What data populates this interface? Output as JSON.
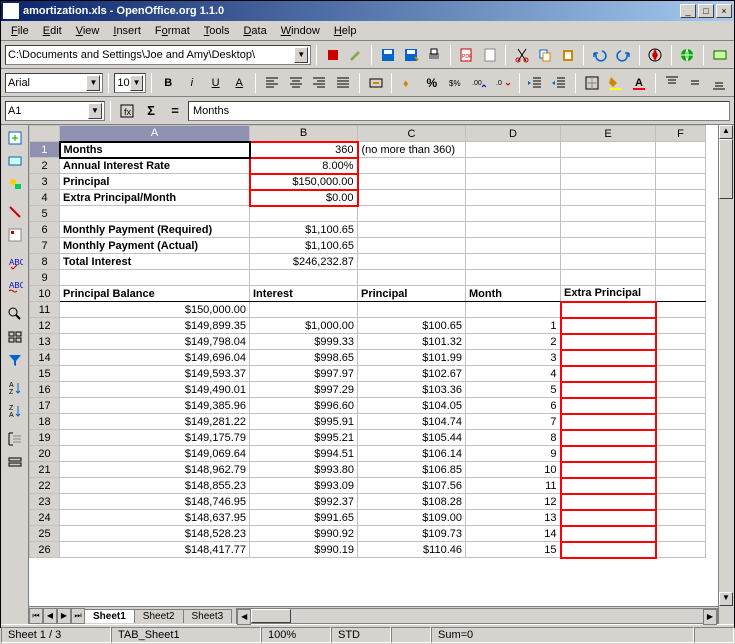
{
  "title": "amortization.xls - OpenOffice.org 1.1.0",
  "menu": [
    "File",
    "Edit",
    "View",
    "Insert",
    "Format",
    "Tools",
    "Data",
    "Window",
    "Help"
  ],
  "path": "C:\\Documents and Settings\\Joe and Amy\\Desktop\\",
  "font": "Arial",
  "fontsize": "10",
  "namebox": "A1",
  "formula": "Months",
  "columns": [
    "A",
    "B",
    "C",
    "D",
    "E",
    "F"
  ],
  "rows_visible": 26,
  "cells": {
    "r1": {
      "A": "Months",
      "B": "360",
      "C": "(no more than 360)"
    },
    "r2": {
      "A": "Annual Interest Rate",
      "B": "8.00%"
    },
    "r3": {
      "A": "Principal",
      "B": "$150,000.00"
    },
    "r4": {
      "A": "Extra Principal/Month",
      "B": "$0.00"
    },
    "r6": {
      "A": "Monthly Payment (Required)",
      "B": "$1,100.65"
    },
    "r7": {
      "A": "Monthly Payment (Actual)",
      "B": "$1,100.65"
    },
    "r8": {
      "A": "Total Interest",
      "B": "$246,232.87"
    },
    "r10": {
      "A": "Principal Balance",
      "B": "Interest",
      "C": "Principal",
      "D": "Month",
      "E": "Extra Principal"
    },
    "r11": {
      "A": "$150,000.00"
    },
    "r12": {
      "A": "$149,899.35",
      "B": "$1,000.00",
      "C": "$100.65",
      "D": "1"
    },
    "r13": {
      "A": "$149,798.04",
      "B": "$999.33",
      "C": "$101.32",
      "D": "2"
    },
    "r14": {
      "A": "$149,696.04",
      "B": "$998.65",
      "C": "$101.99",
      "D": "3"
    },
    "r15": {
      "A": "$149,593.37",
      "B": "$997.97",
      "C": "$102.67",
      "D": "4"
    },
    "r16": {
      "A": "$149,490.01",
      "B": "$997.29",
      "C": "$103.36",
      "D": "5"
    },
    "r17": {
      "A": "$149,385.96",
      "B": "$996.60",
      "C": "$104.05",
      "D": "6"
    },
    "r18": {
      "A": "$149,281.22",
      "B": "$995.91",
      "C": "$104.74",
      "D": "7"
    },
    "r19": {
      "A": "$149,175.79",
      "B": "$995.21",
      "C": "$105.44",
      "D": "8"
    },
    "r20": {
      "A": "$149,069.64",
      "B": "$994.51",
      "C": "$106.14",
      "D": "9"
    },
    "r21": {
      "A": "$148,962.79",
      "B": "$993.80",
      "C": "$106.85",
      "D": "10"
    },
    "r22": {
      "A": "$148,855.23",
      "B": "$993.09",
      "C": "$107.56",
      "D": "11"
    },
    "r23": {
      "A": "$148,746.95",
      "B": "$992.37",
      "C": "$108.28",
      "D": "12"
    },
    "r24": {
      "A": "$148,637.95",
      "B": "$991.65",
      "C": "$109.00",
      "D": "13"
    },
    "r25": {
      "A": "$148,528.23",
      "B": "$990.92",
      "C": "$109.73",
      "D": "14"
    },
    "r26": {
      "A": "$148,417.77",
      "B": "$990.19",
      "C": "$110.46",
      "D": "15"
    }
  },
  "tabs": [
    "Sheet1",
    "Sheet2",
    "Sheet3"
  ],
  "status": {
    "left": "Sheet 1 / 3",
    "tab": "TAB_Sheet1",
    "zoom": "100%",
    "mode": "STD",
    "sum": "Sum=0"
  },
  "chart_data": {
    "type": "table",
    "title": "Amortization schedule",
    "inputs": {
      "Months": 360,
      "Annual Interest Rate": 0.08,
      "Principal": 150000.0,
      "Extra Principal/Month": 0.0
    },
    "outputs": {
      "Monthly Payment (Required)": 1100.65,
      "Monthly Payment (Actual)": 1100.65,
      "Total Interest": 246232.87
    },
    "headers": [
      "Principal Balance",
      "Interest",
      "Principal",
      "Month",
      "Extra Principal"
    ],
    "rows": [
      [
        150000.0,
        null,
        null,
        null,
        null
      ],
      [
        149899.35,
        1000.0,
        100.65,
        1,
        null
      ],
      [
        149798.04,
        999.33,
        101.32,
        2,
        null
      ],
      [
        149696.04,
        998.65,
        101.99,
        3,
        null
      ],
      [
        149593.37,
        997.97,
        102.67,
        4,
        null
      ],
      [
        149490.01,
        997.29,
        103.36,
        5,
        null
      ],
      [
        149385.96,
        996.6,
        104.05,
        6,
        null
      ],
      [
        149281.22,
        995.91,
        104.74,
        7,
        null
      ],
      [
        149175.79,
        995.21,
        105.44,
        8,
        null
      ],
      [
        149069.64,
        994.51,
        106.14,
        9,
        null
      ],
      [
        148962.79,
        993.8,
        106.85,
        10,
        null
      ],
      [
        148855.23,
        993.09,
        107.56,
        11,
        null
      ],
      [
        148746.95,
        992.37,
        108.28,
        12,
        null
      ],
      [
        148637.95,
        991.65,
        109.0,
        13,
        null
      ],
      [
        148528.23,
        990.92,
        109.73,
        14,
        null
      ],
      [
        148417.77,
        990.19,
        110.46,
        15,
        null
      ]
    ]
  }
}
